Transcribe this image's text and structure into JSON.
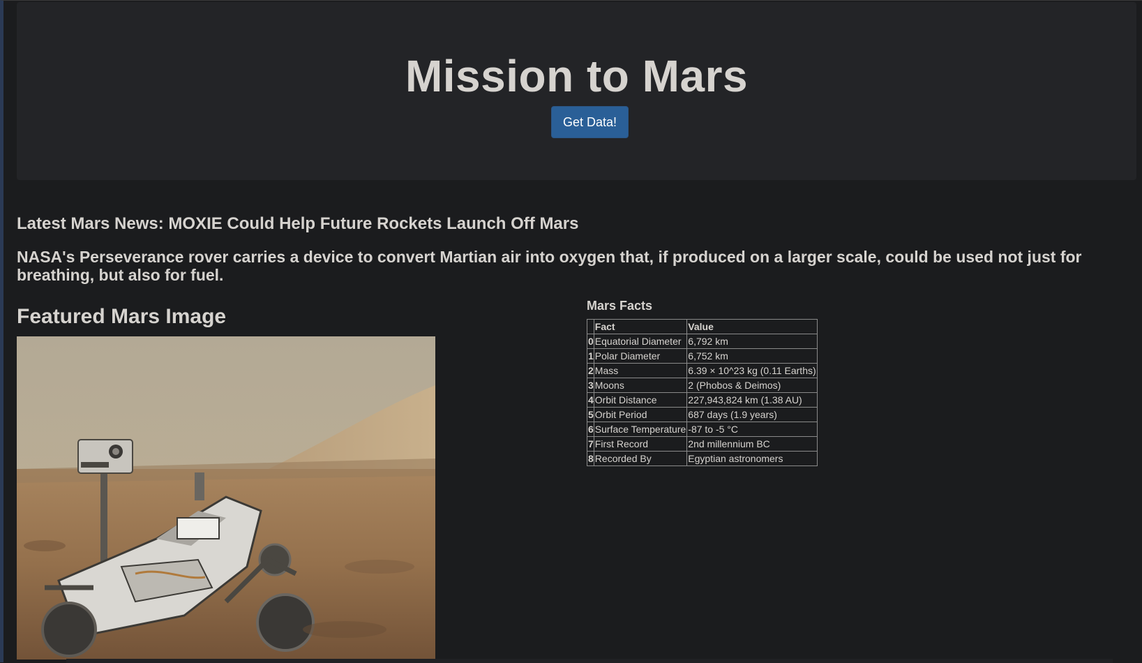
{
  "header": {
    "title": "Mission to Mars",
    "button_label": "Get Data!"
  },
  "news": {
    "title": "Latest Mars News: MOXIE Could Help Future Rockets Launch Off Mars",
    "teaser": "NASA's Perseverance rover carries a device to convert Martian air into oxygen that, if produced on a larger scale, could be used not just for breathing, but also for fuel."
  },
  "featured": {
    "heading": "Featured Mars Image"
  },
  "facts": {
    "heading": "Mars Facts",
    "columns": [
      "Fact",
      "Value"
    ],
    "rows": [
      {
        "index": "0",
        "fact": "Equatorial Diameter",
        "value": "6,792 km"
      },
      {
        "index": "1",
        "fact": "Polar Diameter",
        "value": "6,752 km"
      },
      {
        "index": "2",
        "fact": "Mass",
        "value": "6.39 × 10^23 kg (0.11 Earths)"
      },
      {
        "index": "3",
        "fact": "Moons",
        "value": "2 (Phobos & Deimos)"
      },
      {
        "index": "4",
        "fact": "Orbit Distance",
        "value": "227,943,824 km (1.38 AU)"
      },
      {
        "index": "5",
        "fact": "Orbit Period",
        "value": "687 days (1.9 years)"
      },
      {
        "index": "6",
        "fact": "Surface Temperature",
        "value": "-87 to -5 °C"
      },
      {
        "index": "7",
        "fact": "First Record",
        "value": "2nd millennium BC"
      },
      {
        "index": "8",
        "fact": "Recorded By",
        "value": "Egyptian astronomers"
      }
    ]
  },
  "colors": {
    "background": "#1b1c1e",
    "jumbotron": "#232427",
    "button": "#2a5f97",
    "text": "#d6d3cf"
  }
}
